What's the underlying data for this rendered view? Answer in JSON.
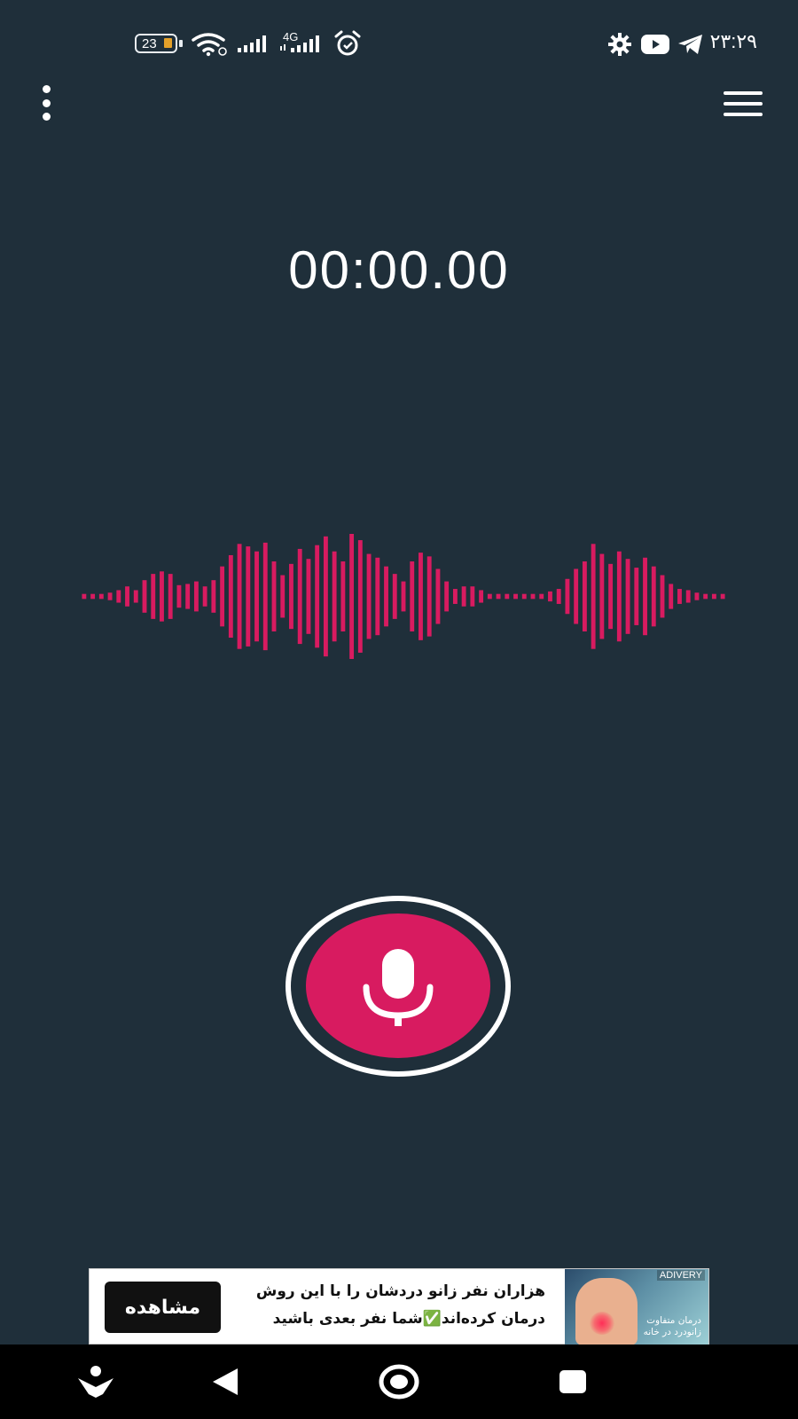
{
  "status_bar": {
    "battery_level": "23",
    "network_label": "4G",
    "clock": "۲۳:۲۹",
    "icons": [
      "battery-icon",
      "wifi-icon",
      "signal-icon",
      "signal-4g-icon",
      "alarm-icon",
      "settings-icon",
      "youtube-icon",
      "telegram-icon"
    ]
  },
  "toolbar": {
    "overflow_icon": "more-vertical-icon",
    "menu_icon": "hamburger-menu-icon"
  },
  "recorder": {
    "timer": "00:00.00",
    "waveform_color": "#d81b60",
    "waveform_levels": [
      0.04,
      0.04,
      0.04,
      0.06,
      0.1,
      0.16,
      0.1,
      0.26,
      0.36,
      0.4,
      0.36,
      0.18,
      0.2,
      0.24,
      0.16,
      0.26,
      0.48,
      0.66,
      0.84,
      0.8,
      0.72,
      0.86,
      0.56,
      0.34,
      0.52,
      0.76,
      0.6,
      0.82,
      0.96,
      0.72,
      0.56,
      1.0,
      0.9,
      0.68,
      0.62,
      0.48,
      0.36,
      0.24,
      0.56,
      0.7,
      0.64,
      0.44,
      0.24,
      0.12,
      0.16,
      0.16,
      0.1,
      0.04,
      0.04,
      0.04,
      0.04,
      0.04,
      0.04,
      0.04,
      0.08,
      0.12,
      0.28,
      0.44,
      0.56,
      0.84,
      0.68,
      0.52,
      0.72,
      0.6,
      0.46,
      0.62,
      0.48,
      0.34,
      0.2,
      0.12,
      0.1,
      0.06,
      0.04,
      0.04,
      0.04
    ],
    "record_icon": "microphone-icon",
    "accent_color": "#d81b60",
    "background_color": "#1f2f3a"
  },
  "ad": {
    "brand": "ADIVERY",
    "line1": "هزاران نفر زانو دردشان را با این روش",
    "line2": "درمان کرده‌اند✅شما نفر بعدی باشید",
    "button_label": "مشاهده",
    "image_text_line1": "درمان متفاوت",
    "image_text_line2": "زانودرد در خانه"
  },
  "nav_bar": {
    "items": [
      "assistant-icon",
      "back-icon",
      "home-icon",
      "recents-icon"
    ]
  }
}
